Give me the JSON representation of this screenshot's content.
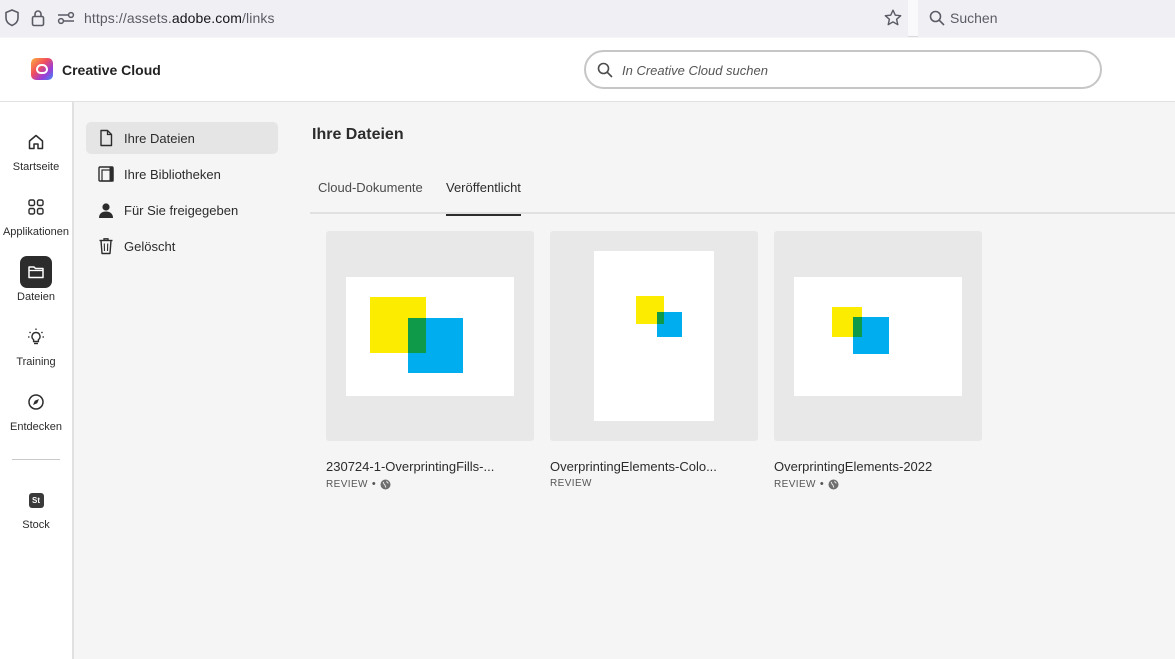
{
  "browser": {
    "url_prefix": "https://assets.",
    "url_domain": "adobe.com",
    "url_path": "/links",
    "search_placeholder": "Suchen"
  },
  "header": {
    "app_name": "Creative Cloud",
    "search_placeholder": "In Creative Cloud suchen"
  },
  "rail": {
    "items": [
      {
        "label": "Startseite",
        "icon": "home-icon"
      },
      {
        "label": "Applikationen",
        "icon": "apps-grid-icon"
      },
      {
        "label": "Dateien",
        "icon": "folder-icon",
        "active": true
      },
      {
        "label": "Training",
        "icon": "lightbulb-icon"
      },
      {
        "label": "Entdecken",
        "icon": "compass-icon"
      },
      {
        "label": "Stock",
        "icon": "stock-icon"
      }
    ],
    "stock_badge": "St"
  },
  "subnav": {
    "items": [
      {
        "label": "Ihre Dateien",
        "icon": "document-icon",
        "active": true
      },
      {
        "label": "Ihre Bibliotheken",
        "icon": "libraries-icon"
      },
      {
        "label": "Für Sie freigegeben",
        "icon": "person-icon"
      },
      {
        "label": "Gelöscht",
        "icon": "trash-icon"
      }
    ]
  },
  "main": {
    "title": "Ihre Dateien",
    "tabs": [
      {
        "label": "Cloud-Dokumente"
      },
      {
        "label": "Veröffentlicht",
        "active": true
      }
    ],
    "files": [
      {
        "name": "230724-1-OverprintingFills-...",
        "status": "REVIEW",
        "public": true
      },
      {
        "name": "OverprintingElements-Colo...",
        "status": "REVIEW",
        "public": false
      },
      {
        "name": "OverprintingElements-2022",
        "status": "REVIEW",
        "public": true
      }
    ]
  },
  "colors": {
    "yellow": "#fcec00",
    "cyan": "#00aeef",
    "overlap": "#0e9a48",
    "active_rail": "#2c2c2c"
  }
}
